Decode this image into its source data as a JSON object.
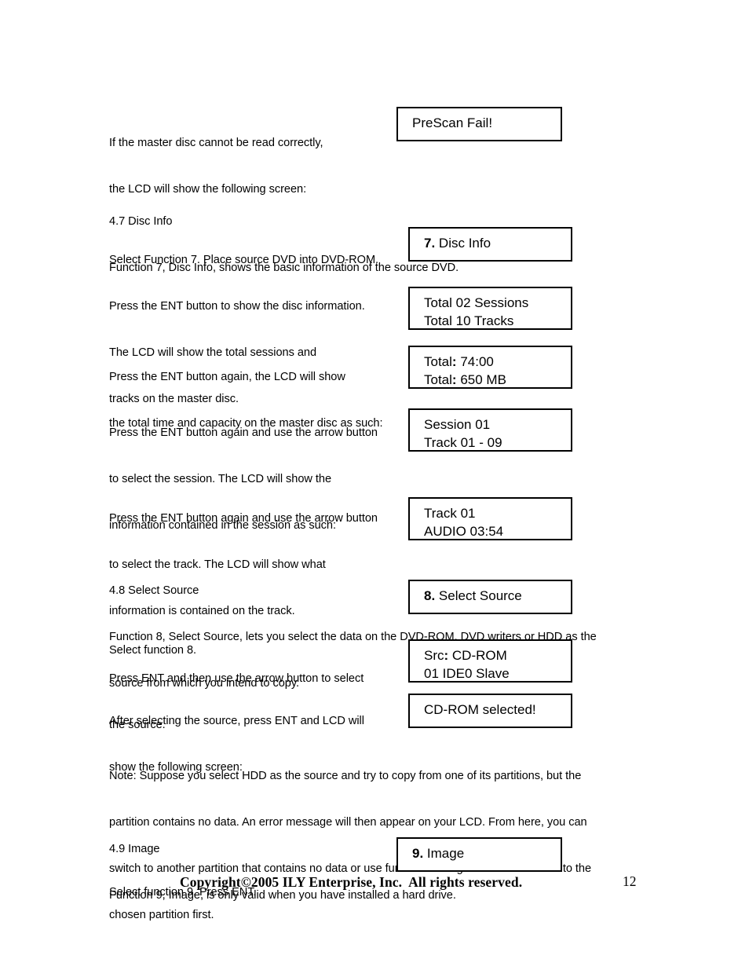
{
  "document": {
    "page_number": "12",
    "footer": "Copyright©2005 ILY Enterprise, Inc.  All rights reserved."
  },
  "paragraphs": {
    "intro_prescan": {
      "line1": "If the master disc cannot be read correctly,",
      "line2": "the LCD will show the following screen:"
    },
    "section_47_heading": "4.7 Disc Info",
    "section_47_desc": "Function 7, Disc Info, shows the basic information of the source DVD.",
    "select_function_7": "Select Function 7. Place source DVD into DVD-ROM.",
    "press_ent_disc_info": {
      "line1": "Press the ENT button to show the disc information.",
      "line2": "The LCD will show the total sessions and",
      "line3": "tracks on the master disc."
    },
    "press_ent_total": {
      "line1": "Press the ENT button again, the LCD will show",
      "line2": "the total time and capacity on the master disc as such:"
    },
    "press_ent_session": {
      "line1": "Press the ENT button again and use the arrow button",
      "line2": "to select the session. The LCD will show the",
      "line3": "information contained in the session as such:"
    },
    "press_ent_track": {
      "line1": "Press the ENT button again and use the arrow button",
      "line2": "to select the track. The LCD will show what",
      "line3": "information is contained on the track."
    },
    "section_48_heading": "4.8 Select Source",
    "section_48_desc": {
      "line1": "Function 8, Select Source, lets you select the data on the DVD-ROM, DVD writers or HDD as the",
      "line2": "source from which you intend to copy."
    },
    "select_function_8": "Select function 8.",
    "press_ent_source": {
      "line1": "Press ENT and then use the arrow button to select",
      "line2": "the source."
    },
    "after_selecting_source": {
      "line1": "After selecting the source, press ENT and LCD will",
      "line2": "show the following screen:"
    },
    "note_hdd": {
      "line1": "Note: Suppose you select HDD as the source and try to copy from one of its partitions, but the",
      "line2": "partition contains no data. An error message will then appear on your LCD. From here, you can",
      "line3": "switch to another partition that contains no data or use function 9 Image to load the data into the",
      "line4": "chosen partition first."
    },
    "section_49_heading": "4.9 Image",
    "section_49_desc": "Function 9, Image, is only valid when you have installed a hard drive.",
    "select_function_9": "Select function 9. Press ENT."
  },
  "lcd_screens": {
    "prescan_fail": {
      "line1": "PreScan Fail!"
    },
    "disc_info": {
      "prefix": "7",
      "dot": ".",
      "label": " Disc Info"
    },
    "total_sessions": {
      "line1": "Total 02 Sessions",
      "line2": "Total 10 Tracks"
    },
    "total_time": {
      "line1_label": "Total",
      "line1_colon": ":",
      "line1_value": " 74:00",
      "line2_label": "Total",
      "line2_colon": ":",
      "line2_value": " 650 MB"
    },
    "session_info": {
      "line1": "Session 01",
      "line2": "Track 01 - 09"
    },
    "track_info": {
      "line1": "Track 01",
      "line2": "AUDIO 03:54"
    },
    "select_source": {
      "prefix": "8",
      "dot": ".",
      "label": " Select Source"
    },
    "src_cdrom": {
      "line1_label": "Src",
      "line1_colon": ":",
      "line1_value": " CD-ROM",
      "line2": "01 IDE0 Slave"
    },
    "cdrom_selected": {
      "line1": "CD-ROM selected!"
    },
    "image": {
      "prefix": "9",
      "dot": ".",
      "label": " Image"
    }
  }
}
